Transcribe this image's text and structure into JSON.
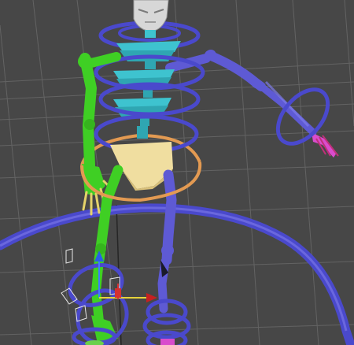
{
  "viewport": {
    "label": "",
    "colors": {
      "background": "#474747",
      "grid": "#6a6a6a",
      "spine_cyan": "#3ec3cf",
      "pelvis_tan": "#f0dea0",
      "left_limb_green": "#3fcf24",
      "right_limb_blue": "#5e5ad4",
      "control_ring_blue": "#4a49cc",
      "pelvis_ring_orange": "#e39a52",
      "hand_magenta": "#d94ccd",
      "finger_yellow": "#e5d36a",
      "head_gray": "#cfcfcf"
    }
  },
  "rig": {
    "head": "head-mesh",
    "spine_segments": 5,
    "control_rings": [
      "neck-control-ring",
      "spine-control-ring",
      "chest-control-ring",
      "waist-control-ring",
      "pelvis-control-ring",
      "right-wrist-control-ring",
      "left-foot-control-ring",
      "right-foot-control-ring",
      "root-control-ring"
    ],
    "gizmo": "transform-gizmo"
  }
}
